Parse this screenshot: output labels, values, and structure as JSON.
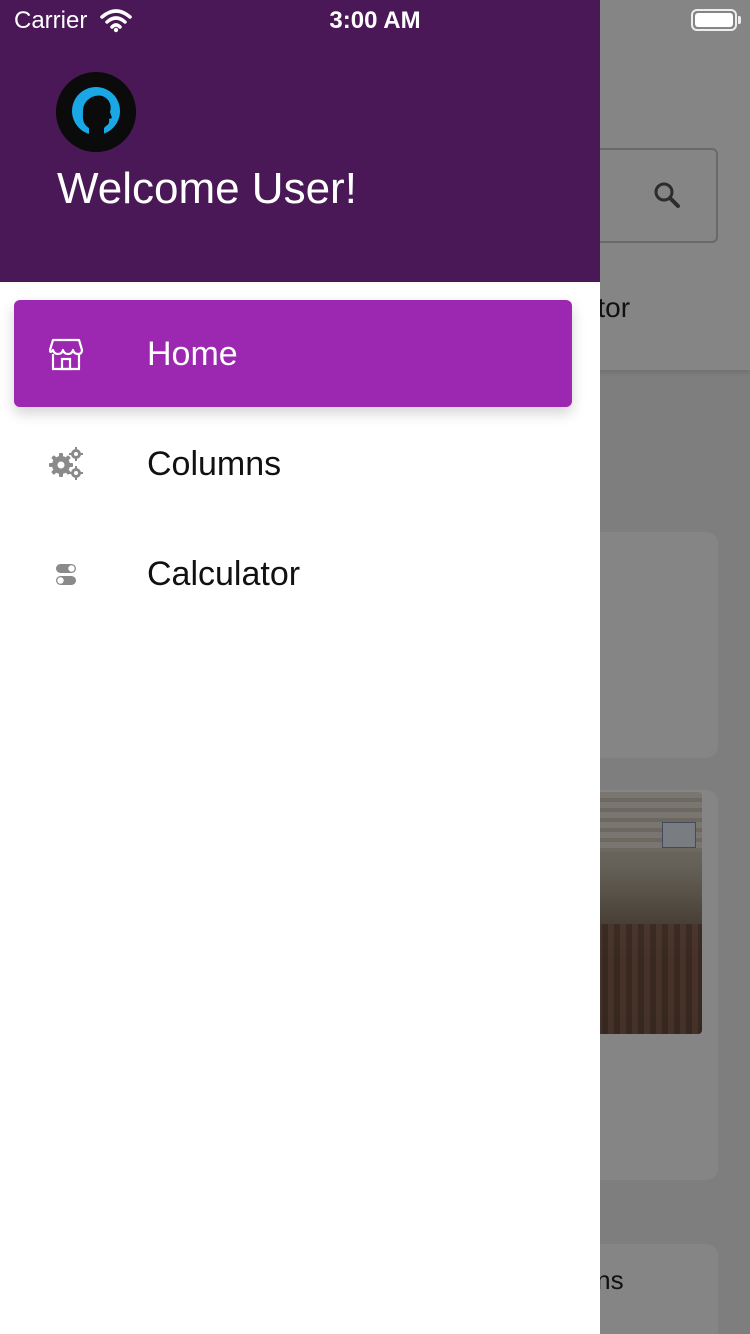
{
  "status_bar": {
    "carrier": "Carrier",
    "time": "3:00 AM"
  },
  "drawer": {
    "welcome_text": "Welcome User!",
    "header_color": "#4a1856",
    "active_color": "#9c27b0",
    "items": [
      {
        "label": "Home",
        "icon": "store-icon",
        "active": true
      },
      {
        "label": "Columns",
        "icon": "gears-icon",
        "active": false
      },
      {
        "label": "Calculator",
        "icon": "toggles-icon",
        "active": false
      }
    ]
  },
  "background": {
    "tab_text": "ulator",
    "card2_text": "ns",
    "card3_text": "umns"
  }
}
